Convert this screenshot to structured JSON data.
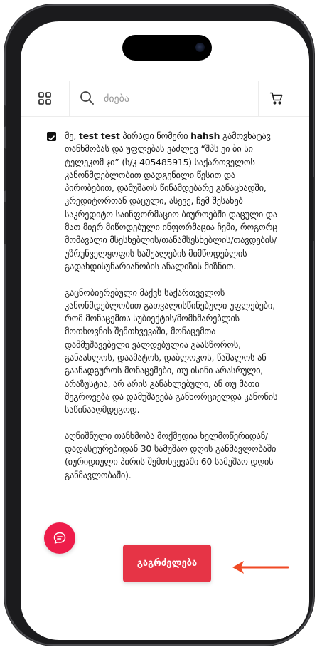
{
  "header": {
    "search_placeholder": "ძიება",
    "icons": [
      "grid-icon",
      "search-icon",
      "cart-icon"
    ]
  },
  "consent": {
    "checked": true,
    "intro_prefix": "მე, ",
    "name": "test test",
    "id_label": " პირადი ნომერი ",
    "id_value": "hahsh",
    "line1_rest": "გამოვხატავ თანხმობას და უფლებას ვაძლევ “შპს ეი ბი სი ტელეკომ ჯი” (ს/კ 405485915) საქართველოს კანონმდებლობით დადგენილი წესით და პირობებით, დამუშაოს წინამდებარე განაცხადში, კრედიტორთან დაცული, ასევე, ჩემ შესახებ საკრედიტო საინფორმაციო ბიუროებში დაცული და მათ მიერ მიწოდებული ინფორმაცია ჩემი, როგორც მომავალი მსესხებლის/თანამსესხებლის/თავდების/უზრუნველყოფის საშუალების მიმწოდებლის გადახდისუნარიანობის ანალიზის მიზნით.",
    "para2": "გაცნობიერებული მაქვს საქართველოს კანონმდებლობით გათვალისწინებული უფლებები, რომ მონაცემთა სუბიექტის/მომხმარებლის მოთხოვნის შემთხვევაში, მონაცემთა დამმუშავებელი ვალდებულია გაასწოროს, განაახლოს, დაამატოს, დაბლოკოს, წაშალოს ან გაანადგუროს მონაცემები, თუ ისინი არასრული, არაზუსტია, არ არის განახლებული, ან თუ მათი შეგროვება და დამუშავება განხორციელდა კანონის საწინააღმდეგოდ.",
    "para3": "აღნიშნული თანხმობა მოქმედია ხელმოწერიდან/დადასტურებიდან 30 სამუშაო დღის განმავლობაში (იურიდიული პირის შემთხვევაში 60 სამუშაო დღის განმავლობაში)."
  },
  "actions": {
    "continue_label": "გაგრძელება"
  },
  "colors": {
    "accent": "#e63446",
    "chat_fab": "#ee1c4a",
    "arrow": "#f04a24"
  }
}
